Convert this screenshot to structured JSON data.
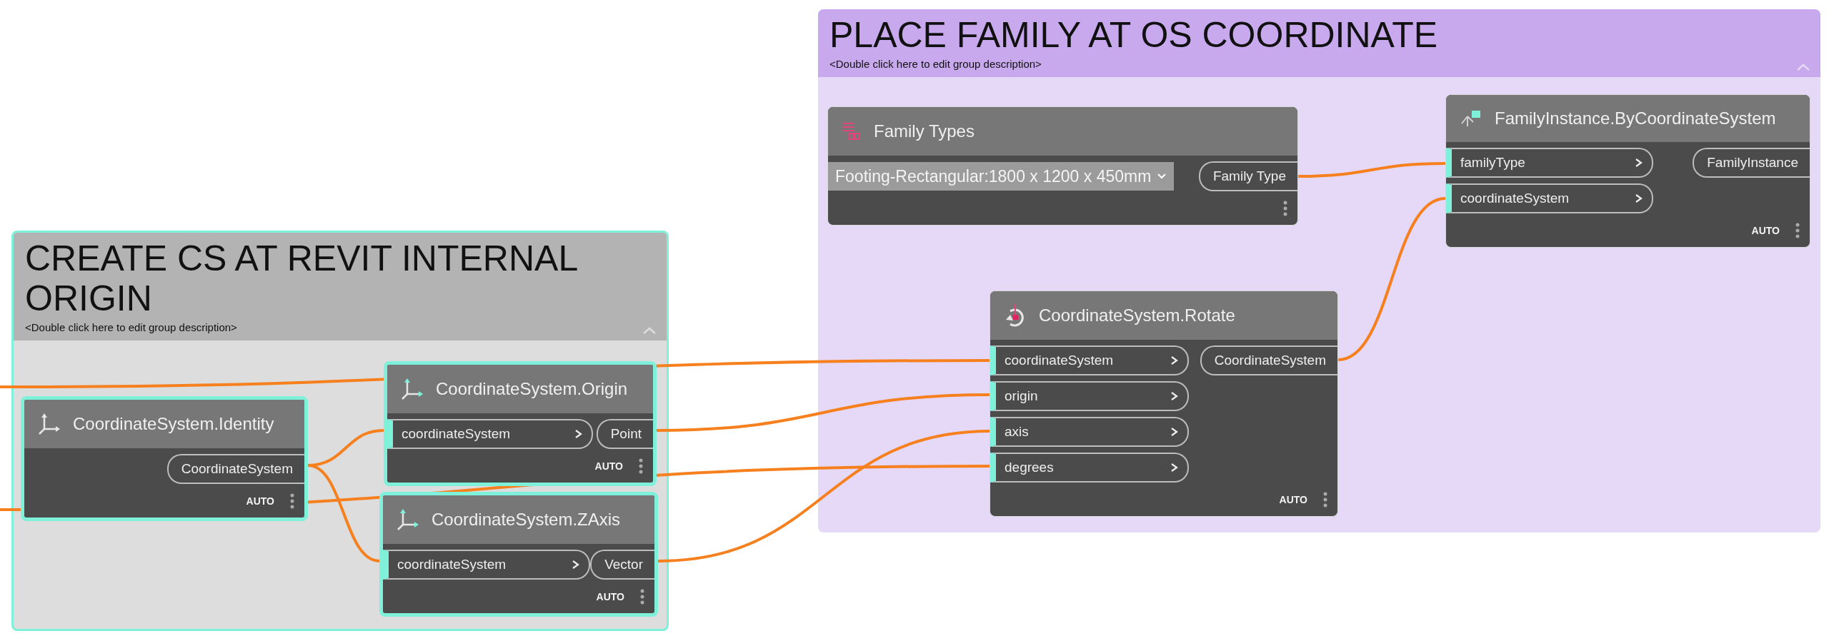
{
  "groups": [
    {
      "title": "CREATE CS AT REVIT INTERNAL ORIGIN",
      "description": "<Double click here to edit group description>",
      "color": "#b3b3b3",
      "selected": true,
      "nodes": [
        {
          "title": "CoordinateSystem.Identity",
          "selected": true,
          "outputs": [
            "CoordinateSystem"
          ],
          "lacing": "AUTO"
        },
        {
          "title": "CoordinateSystem.Origin",
          "selected": true,
          "inputs": [
            "coordinateSystem"
          ],
          "outputs": [
            "Point"
          ],
          "lacing": "AUTO"
        },
        {
          "title": "CoordinateSystem.ZAxis",
          "selected": true,
          "inputs": [
            "coordinateSystem"
          ],
          "outputs": [
            "Vector"
          ],
          "lacing": "AUTO"
        }
      ]
    },
    {
      "title": "PLACE FAMILY AT OS COORDINATE",
      "description": "<Double click here to edit group description>",
      "color": "#c8a9ed",
      "selected": false,
      "nodes": [
        {
          "title": "Family Types",
          "selected": false,
          "dropdown": "Footing-Rectangular:1800 x 1200 x 450mm",
          "outputs": [
            "Family Type"
          ]
        },
        {
          "title": "FamilyInstance.ByCoordinateSystem",
          "selected": false,
          "inputs": [
            "familyType",
            "coordinateSystem"
          ],
          "outputs": [
            "FamilyInstance"
          ],
          "lacing": "AUTO"
        },
        {
          "title": "CoordinateSystem.Rotate",
          "selected": false,
          "inputs": [
            "coordinateSystem",
            "origin",
            "axis",
            "degrees"
          ],
          "outputs": [
            "CoordinateSystem"
          ],
          "lacing": "AUTO"
        }
      ]
    }
  ]
}
